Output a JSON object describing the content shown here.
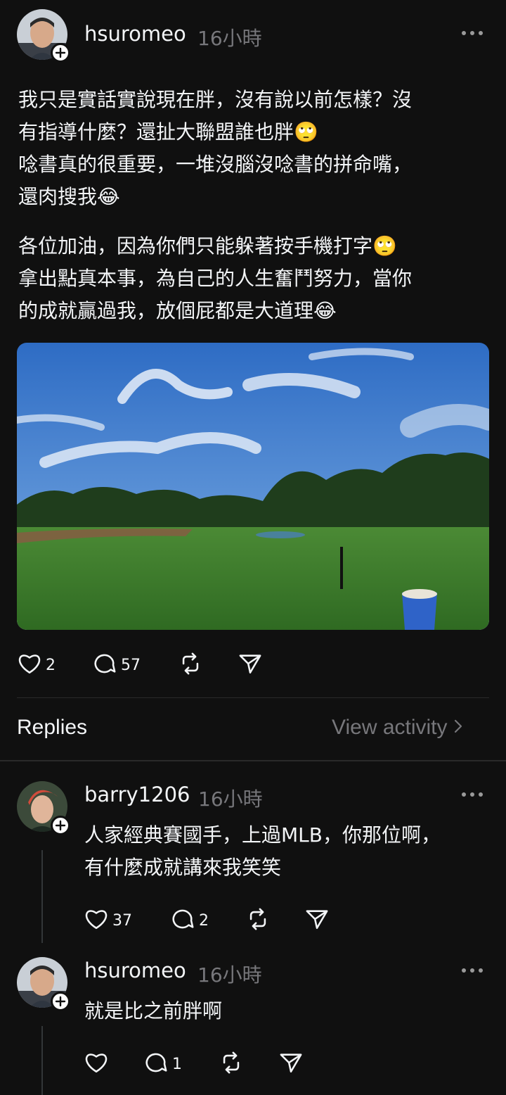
{
  "post": {
    "username": "hsuromeo",
    "time": "16小時",
    "paragraph1": "我只是實話實說現在胖，沒有說以前怎樣？沒\n有指導什麼？還扯大聯盟誰也胖🙄\n唸書真的很重要，一堆沒腦沒唸書的拼命嘴，\n還肉搜我😂",
    "paragraph2": "各位加油，因為你們只能躲著按手機打字🙄\n拿出點真本事，為自己的人生奮鬥努力，當你\n的成就贏過我，放個屁都是大道理😂",
    "likes": "2",
    "comments": "57"
  },
  "replies_header": {
    "label": "Replies",
    "view_activity": "View activity"
  },
  "replies": [
    {
      "username": "barry1206",
      "time": "16小時",
      "text": "人家經典賽國手，上過MLB，你那位啊，\n有什麼成就講來我笑笑",
      "likes": "37",
      "comments": "2"
    },
    {
      "username": "hsuromeo",
      "time": "16小時",
      "text": "就是比之前胖啊",
      "likes": "",
      "comments": "1"
    }
  ],
  "colors": {
    "background": "#101010",
    "text": "#f3f5f7",
    "muted": "#77777b"
  }
}
